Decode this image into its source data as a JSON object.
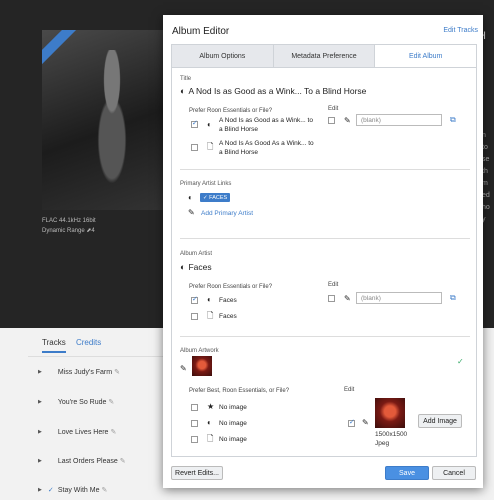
{
  "background": {
    "format": "FLAC 44.1kHz 16bit",
    "dynamic_range": "Dynamic Range",
    "dynamic_range_value": "4",
    "right_header": "H",
    "right_text": "n\nto\nse\nth\nm\ned\nho\ny",
    "tabs": {
      "tracks": "Tracks",
      "credits": "Credits"
    },
    "tracks": [
      {
        "title": "Miss Judy's Farm",
        "checked": false
      },
      {
        "title": "You're So Rude",
        "checked": false
      },
      {
        "title": "Love Lives Here",
        "checked": false
      },
      {
        "title": "Last Orders Please",
        "checked": false
      },
      {
        "title": "Stay With Me",
        "checked": true
      }
    ]
  },
  "modal": {
    "title": "Album Editor",
    "edit_tracks": "Edit Tracks",
    "tabs": [
      "Album Options",
      "Metadata Preference",
      "Edit Album"
    ],
    "title_section": {
      "label": "Title",
      "current": "A Nod Is as Good as a Wink... To a Blind Horse",
      "prefer_label": "Prefer Roon Essentials or File?",
      "edit_label": "Edit",
      "options": [
        {
          "text": "A Nod Is as Good as a Wink... to a Blind Horse",
          "checked": true
        },
        {
          "text": "A Nod Is As Good As a Wink... to a Blind Horse",
          "checked": false
        }
      ],
      "edit_placeholder": "(blank)"
    },
    "artist_links": {
      "label": "Primary Artist Links",
      "chip": "FACES",
      "add_link": "Add Primary Artist"
    },
    "album_artist": {
      "label": "Album Artist",
      "current": "Faces",
      "prefer_label": "Prefer Roon Essentials or File?",
      "edit_label": "Edit",
      "options": [
        {
          "text": "Faces",
          "checked": true
        },
        {
          "text": "Faces",
          "checked": false
        }
      ],
      "edit_placeholder": "(blank)"
    },
    "artwork": {
      "label": "Album Artwork",
      "prefer_label": "Prefer Best, Roon Essentials, or File?",
      "edit_label": "Edit",
      "options": [
        "No image",
        "No image",
        "No image"
      ],
      "size": "1500x1500",
      "type": "Jpeg",
      "add_image": "Add Image"
    },
    "buttons": {
      "revert": "Revert Edits...",
      "save": "Save",
      "cancel": "Cancel"
    }
  },
  "colors": {
    "accent": "#3d7cc9",
    "primary_button": "#4a90e2"
  }
}
